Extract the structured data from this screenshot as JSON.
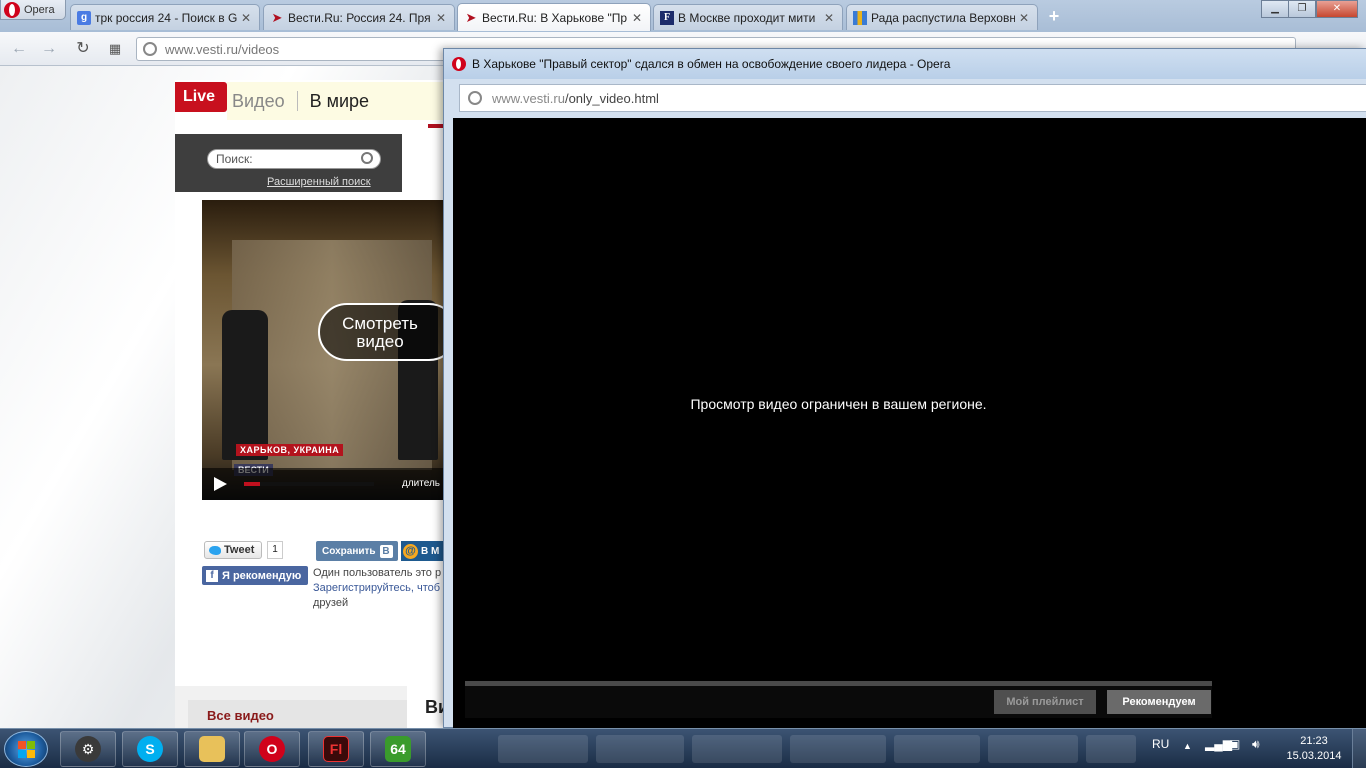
{
  "browser": {
    "menu_label": "Opera",
    "tabs": [
      {
        "title": "трк россия 24 - Поиск в G",
        "favicon": "google-icon"
      },
      {
        "title": "Вести.Ru: Россия 24. Пря",
        "favicon": "vesti-icon"
      },
      {
        "title": "Вести.Ru: В Харькове \"Пр",
        "favicon": "vesti-icon"
      },
      {
        "title": "В Москве проходит мити",
        "favicon": "f-icon"
      },
      {
        "title": "Рада распустила Верховн",
        "favicon": "bars-icon"
      }
    ],
    "address": "www.vesti.ru/videos"
  },
  "page": {
    "live_label": "Live",
    "section": "Видео",
    "subsection": "В мире",
    "search_placeholder": "Поиск:",
    "advanced_search": "Расширенный поиск",
    "watch_button": "Смотреть видео",
    "location_caption": "ХАРЬКОВ, УКРАИНА",
    "channel_caption": "ВЕСТИ",
    "duration_label": "длитель",
    "tweet_label": "Tweet",
    "tweet_count": "1",
    "vk_label": "Сохранить",
    "mail_label": "В М",
    "fb_label": "Я рекомендую",
    "fb_text_line1": "Один пользователь это р",
    "fb_text_line2": "Зарегистрируйтесь, чтоб",
    "fb_text_line3": "друзей",
    "all_videos": "Все видео",
    "heading_partial": "Ви"
  },
  "popup": {
    "title": "В Харькове \"Правый сектор\" сдался в обмен на освобождение своего лидера - Opera",
    "address_host": "www.vesti.ru",
    "address_path": "/only_video.html",
    "message": "Просмотр видео ограничен в вашем регионе.",
    "playlist_button": "Мой плейлист",
    "recommend_button": "Рекомендуем"
  },
  "taskbar": {
    "language": "RU",
    "time": "21:23",
    "date": "15.03.2014"
  }
}
